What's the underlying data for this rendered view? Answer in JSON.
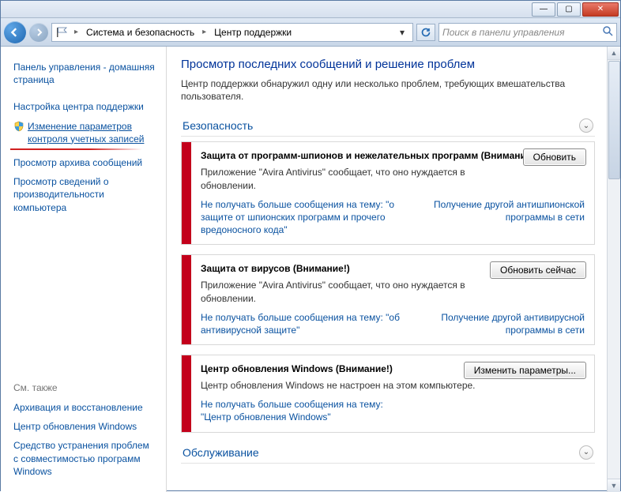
{
  "breadcrumb": {
    "item1": "Система и безопасность",
    "item2": "Центр поддержки"
  },
  "search": {
    "placeholder": "Поиск в панели управления"
  },
  "sidebar": {
    "home": "Панель управления - домашняя страница",
    "links": [
      "Настройка центра поддержки",
      "Изменение параметров контроля учетных записей",
      "Просмотр архива сообщений",
      "Просмотр сведений о производительности компьютера"
    ],
    "see_also_hd": "См. также",
    "see_also": [
      "Архивация и восстановление",
      "Центр обновления Windows",
      "Средство устранения проблем с совместимостью программ Windows"
    ]
  },
  "page": {
    "title": "Просмотр последних сообщений и решение проблем",
    "intro": "Центр поддержки обнаружил одну или несколько проблем, требующих вмешательства пользователя."
  },
  "sections": {
    "security": "Безопасность",
    "maintenance": "Обслуживание"
  },
  "cards": [
    {
      "title": "Защита от программ-шпионов и нежелательных программ (Внимание!)",
      "desc": "Приложение \"Avira Antivirus\" сообщает, что оно нуждается в обновлении.",
      "btn": "Обновить",
      "link_left": "Не получать больше сообщения на тему: \"о защите от шпионских программ и прочего вредоносного кода\"",
      "link_right": "Получение другой антишпионской программы в сети"
    },
    {
      "title": "Защита от вирусов  (Внимание!)",
      "desc": "Приложение \"Avira Antivirus\" сообщает, что оно нуждается в обновлении.",
      "btn": "Обновить сейчас",
      "link_left": "Не получать больше сообщения на тему: \"об антивирусной защите\"",
      "link_right": "Получение другой антивирусной программы в сети"
    },
    {
      "title": "Центр обновления Windows  (Внимание!)",
      "desc": "Центр обновления Windows не настроен на этом компьютере.",
      "btn": "Изменить параметры...",
      "link_left": "Не получать больше сообщения на тему: \"Центр обновления Windows\"",
      "link_right": ""
    }
  ]
}
